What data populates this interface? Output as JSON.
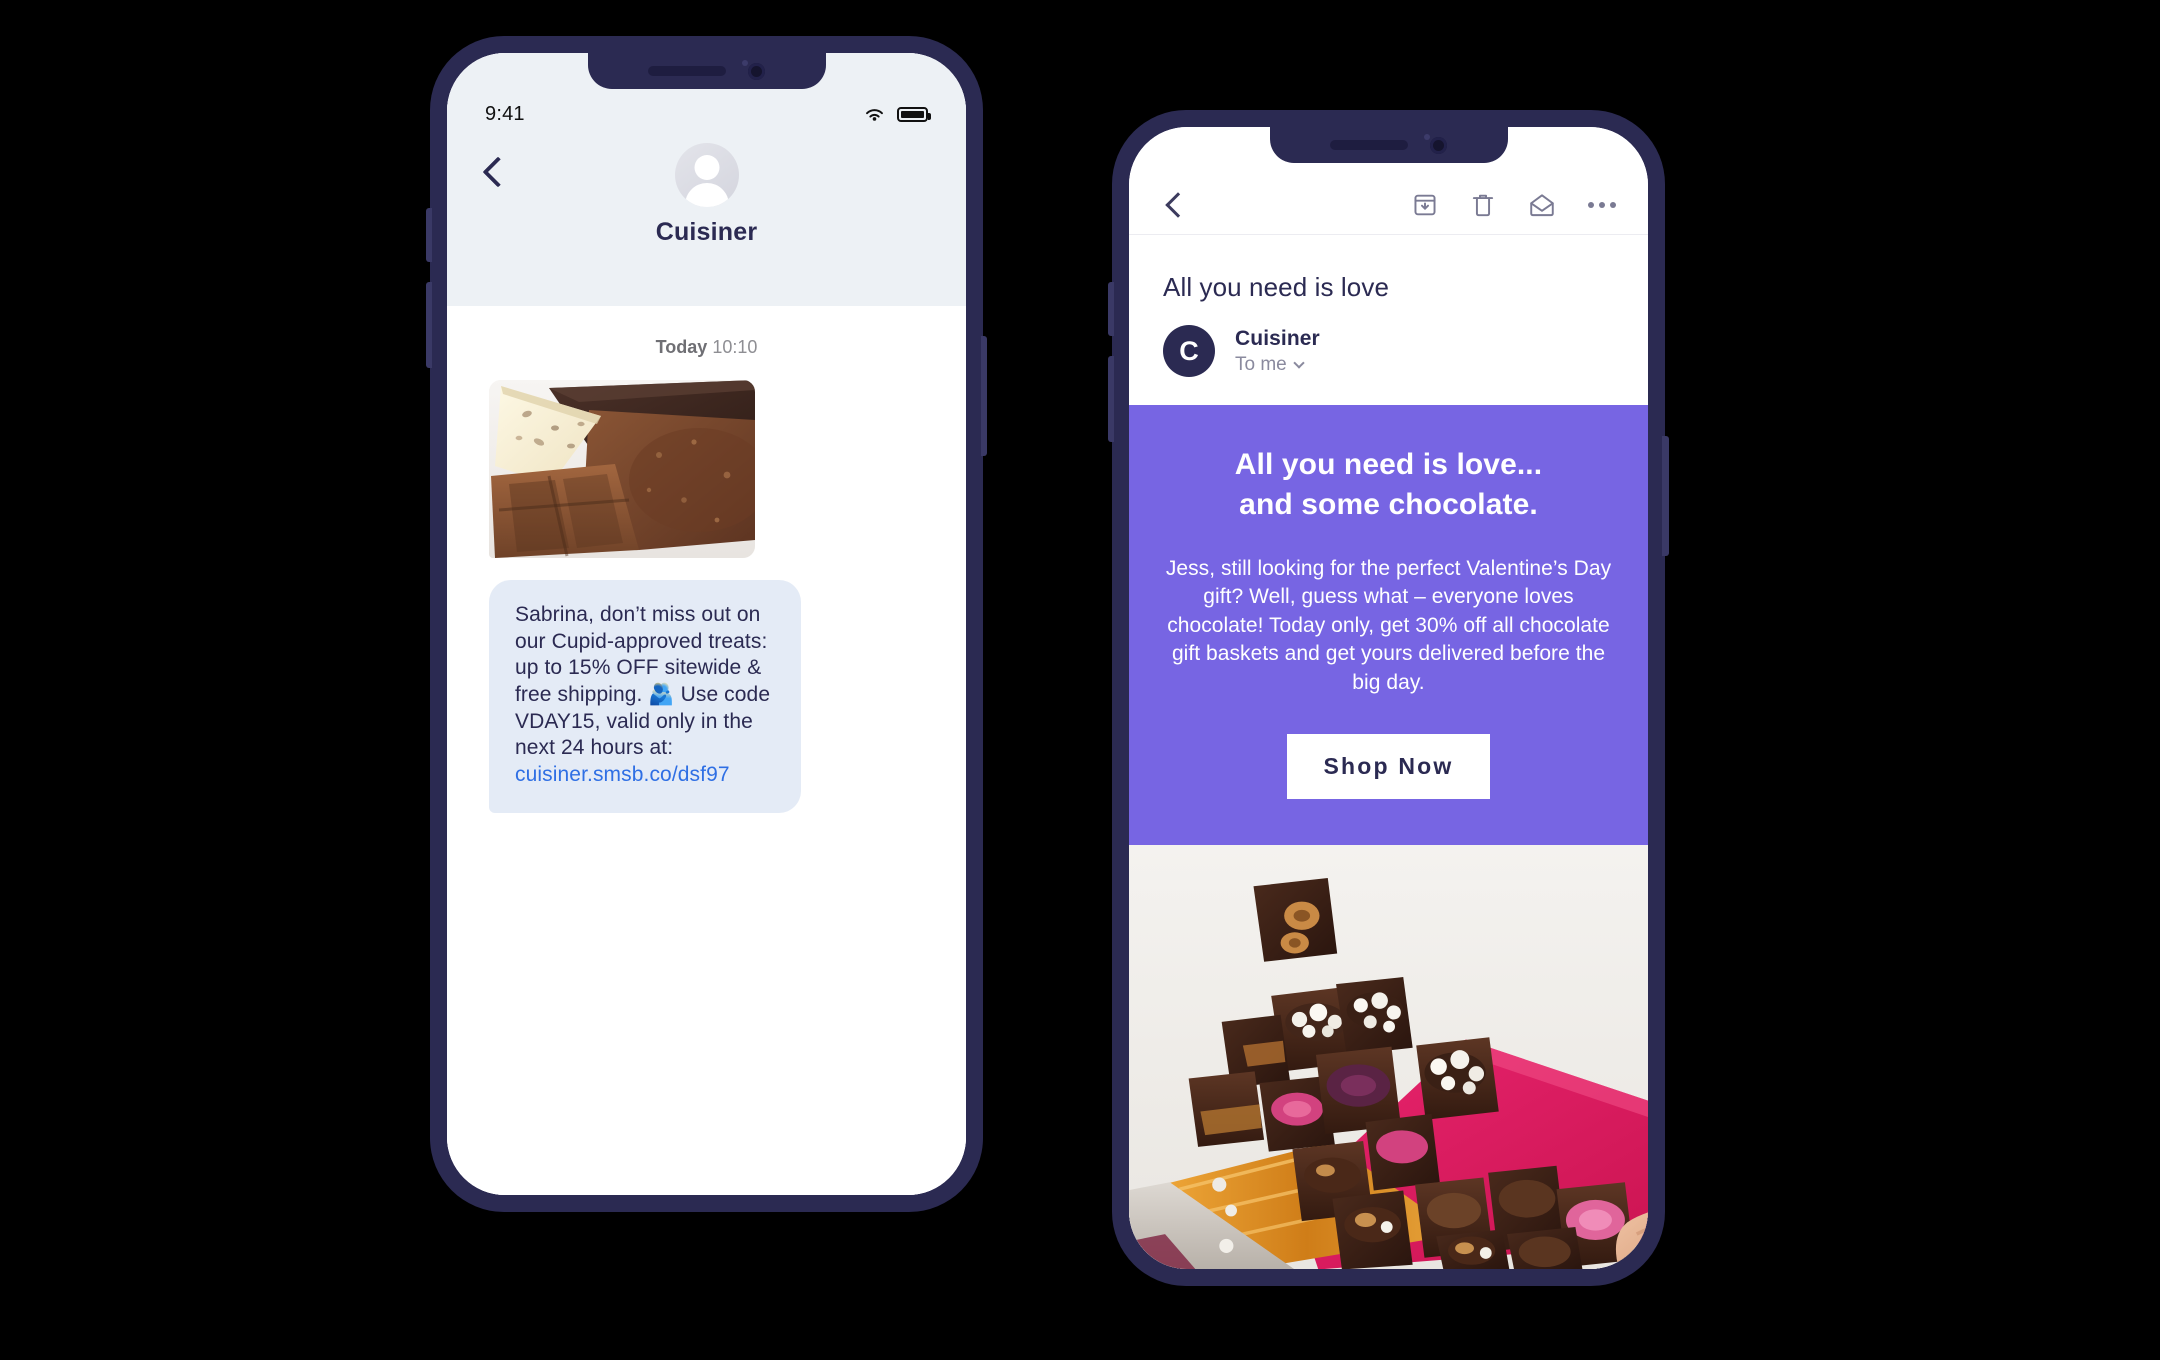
{
  "colors": {
    "frame": "#2B2A52",
    "sms_header_bg": "#edf1f5",
    "bubble_bg": "#e4ebf6",
    "link": "#2f6fe4",
    "promo_bg": "#7765E3",
    "avatar_bg": "#2B2A52"
  },
  "phone_sms": {
    "status": {
      "time": "9:41",
      "wifi_icon": "wifi-icon",
      "battery_icon": "battery-icon"
    },
    "nav": {
      "back_icon": "back-chevron-icon",
      "avatar_icon": "contact-avatar-icon",
      "contact_name": "Cuisiner"
    },
    "thread": {
      "day_label": "Today",
      "time_label": "10:10",
      "attachment_alt": "chocolate-bars-photo",
      "message_text": "Sabrina, don’t miss out on our Cupid-approved treats: up to 15% OFF sitewide & free shipping. 🫂 Use code VDAY15, valid only in the next 24 hours at: ",
      "message_link": "cuisiner.smsb.co/dsf97"
    }
  },
  "phone_email": {
    "toolbar": {
      "back_icon": "back-chevron-icon",
      "archive_icon": "archive-icon",
      "delete_icon": "trash-icon",
      "unread_icon": "open-envelope-icon",
      "more_icon": "more-options-icon"
    },
    "subject": "All you need is love",
    "sender": {
      "avatar_initial": "C",
      "name": "Cuisiner",
      "recipient": "To me",
      "expand_icon": "chevron-down-icon"
    },
    "promo": {
      "headline_line1": "All you need is love...",
      "headline_line2": "and some chocolate.",
      "body": "Jess, still looking for the perfect Valentine’s Day gift? Well, guess what – everyone loves chocolate! Today only, get 30% off all chocolate gift baskets and get yours delivered before the big day.",
      "cta_label": "Shop Now",
      "hero_alt": "chocolate-gift-box-photo"
    }
  }
}
